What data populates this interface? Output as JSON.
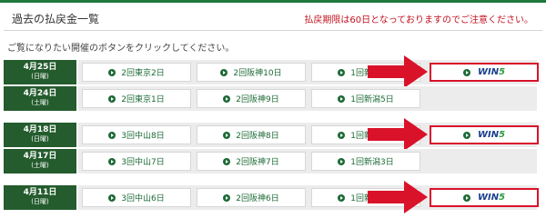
{
  "header": {
    "title": "過去の払戻金一覧",
    "notice": "払戻期限は60日となっておりますのでご注意ください。"
  },
  "instruction": "ご覧になりたい開催のボタンをクリックしてください。",
  "win5_label": "WIN5",
  "colors": {
    "header_bar": "#1e7a3c",
    "date_cell": "#245c2e",
    "win5_border": "#d9122a",
    "arrow": "#d9122a",
    "link_text": "#1c6a36"
  },
  "groups": [
    {
      "rows": [
        {
          "date": "4月25日",
          "day": "(日曜)",
          "venues": [
            "2回東京2日",
            "2回阪神10日",
            "1回新潟6日"
          ],
          "win5": true
        },
        {
          "date": "4月24日",
          "day": "(土曜)",
          "venues": [
            "2回東京1日",
            "2回阪神9日",
            "1回新潟5日"
          ],
          "win5": false
        }
      ]
    },
    {
      "rows": [
        {
          "date": "4月18日",
          "day": "(日曜)",
          "venues": [
            "3回中山8日",
            "2回阪神8日",
            "1回新潟4日"
          ],
          "win5": true
        },
        {
          "date": "4月17日",
          "day": "(土曜)",
          "venues": [
            "3回中山7日",
            "2回阪神7日",
            "1回新潟3日"
          ],
          "win5": false
        }
      ]
    },
    {
      "rows": [
        {
          "date": "4月11日",
          "day": "(日曜)",
          "venues": [
            "3回中山6日",
            "2回阪神6日",
            "1回新潟2日"
          ],
          "win5": true
        }
      ]
    }
  ]
}
